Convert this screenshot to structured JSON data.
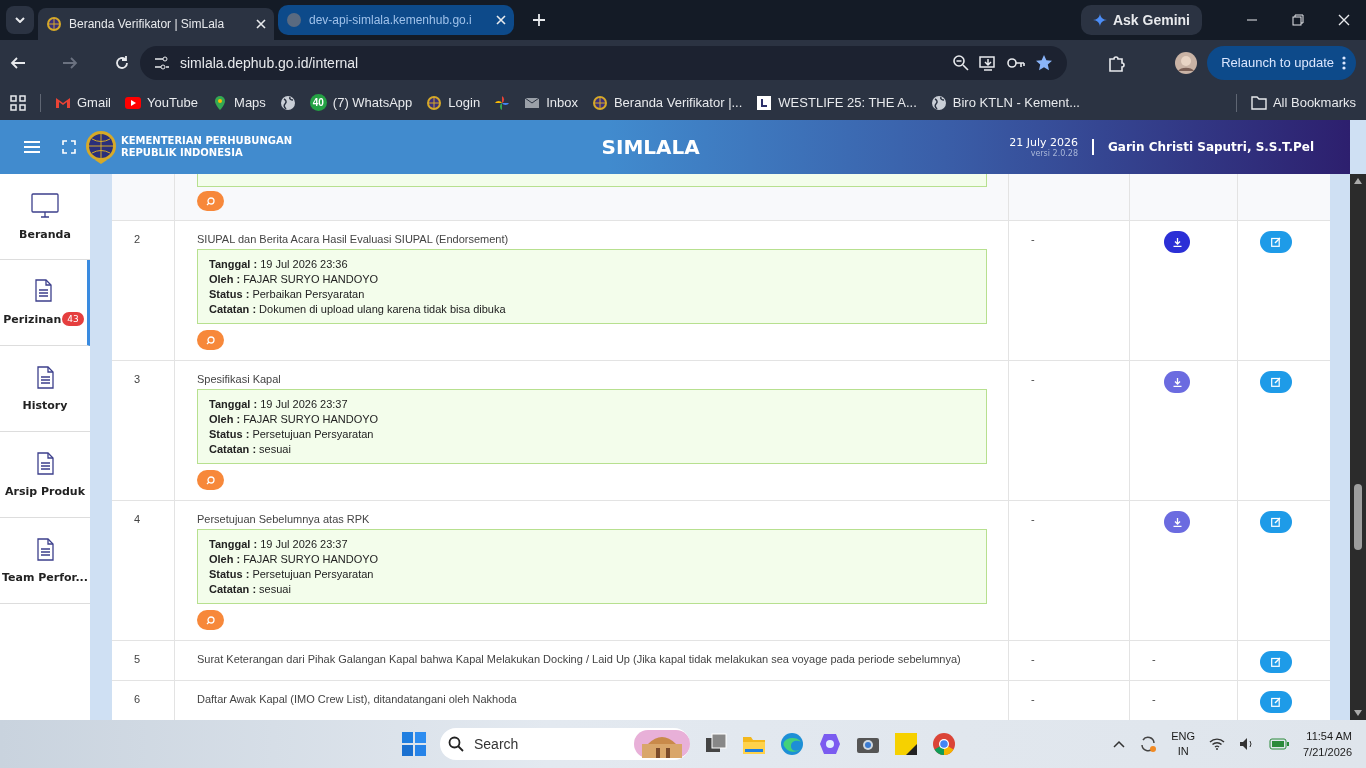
{
  "browser": {
    "tabs": [
      {
        "title": "Beranda Verifikator | SimLala",
        "selected": true
      },
      {
        "title": "dev-api-simlala.kemenhub.go.i",
        "selected": false
      }
    ],
    "gemini": "Ask Gemini",
    "address": "simlala.dephub.go.id/internal",
    "relaunch": "Relaunch to update",
    "bookmarks": [
      {
        "kind": "gmail",
        "label": "Gmail"
      },
      {
        "kind": "youtube",
        "label": "YouTube"
      },
      {
        "kind": "maps",
        "label": "Maps"
      },
      {
        "kind": "globe"
      },
      {
        "kind": "whatsapp",
        "badge": "40",
        "label": "(7) WhatsApp"
      },
      {
        "kind": "emblem",
        "label": "Login"
      },
      {
        "kind": "pinwheel"
      },
      {
        "kind": "mail",
        "label": "Inbox"
      },
      {
        "kind": "emblem",
        "label": "Beranda Verifikator |..."
      },
      {
        "kind": "letter",
        "label": "WESTLIFE 25: THE A..."
      },
      {
        "kind": "globe",
        "label": "Biro KTLN - Kement..."
      }
    ],
    "all_bookmarks": "All Bookmarks"
  },
  "header": {
    "org_line_1": "KEMENTERIAN PERHUBUNGAN",
    "org_line_2": "REPUBLIK INDONESIA",
    "title": "SIMLALA",
    "date": "21 July 2026",
    "version": "versi 2.0.28",
    "user": "Garin Christi Saputri, S.S.T.Pel"
  },
  "sidebar": {
    "items": [
      {
        "kind": "monitor",
        "label": "Beranda",
        "selected": false
      },
      {
        "kind": "document",
        "label": "Perizinan",
        "badge": "43",
        "selected": true
      },
      {
        "kind": "document",
        "label": "History",
        "selected": false
      },
      {
        "kind": "document",
        "label": "Arsip Produk",
        "selected": false
      },
      {
        "kind": "document",
        "label": "Team Perfor...",
        "selected": false
      }
    ]
  },
  "table": {
    "rows": [
      {
        "kind": "clipped"
      },
      {
        "kind": "entry",
        "number": "2",
        "title": "SIUPAL dan Berita Acara Hasil Evaluasi SIUPAL (Endorsement)",
        "details": [
          {
            "label": "Tanggal :",
            "value": "19 Jul 2026 23:36"
          },
          {
            "label": "Oleh :",
            "value": "FAJAR SURYO HANDOYO"
          },
          {
            "label": "Status :",
            "value": "Perbaikan Persyaratan"
          },
          {
            "label": "Catatan :",
            "value": "Dokumen di upload ulang karena tidak bisa dibuka"
          }
        ],
        "column_3": "-",
        "download": {
          "color": "#2b2fd6"
        }
      },
      {
        "kind": "entry",
        "number": "3",
        "title": "Spesifikasi Kapal",
        "details": [
          {
            "label": "Tanggal :",
            "value": "19 Jul 2026 23:37"
          },
          {
            "label": "Oleh :",
            "value": "FAJAR SURYO HANDOYO"
          },
          {
            "label": "Status :",
            "value": "Persetujuan Persyaratan"
          },
          {
            "label": "Catatan :",
            "value": "sesuai"
          }
        ],
        "column_3": "-",
        "download": {
          "color": "#6b6be0"
        }
      },
      {
        "kind": "entry",
        "number": "4",
        "title": "Persetujuan Sebelumnya atas RPK",
        "details": [
          {
            "label": "Tanggal :",
            "value": "19 Jul 2026 23:37"
          },
          {
            "label": "Oleh :",
            "value": "FAJAR SURYO HANDOYO"
          },
          {
            "label": "Status :",
            "value": "Persetujuan Persyaratan"
          },
          {
            "label": "Catatan :",
            "value": "sesuai"
          }
        ],
        "column_3": "-",
        "download": {
          "color": "#6b6be0"
        }
      },
      {
        "kind": "plain",
        "number": "5",
        "title": "Surat Keterangan dari Pihak Galangan Kapal bahwa Kapal Melakukan Docking / Laid Up (Jika kapal tidak melakukan sea voyage pada periode sebelumnya)",
        "column_3": "-",
        "column_4": "-"
      },
      {
        "kind": "plain",
        "number": "6",
        "title": "Daftar Awak Kapal (IMO Crew List), ditandatangani oleh Nakhoda",
        "column_3": "-",
        "column_4": "-"
      }
    ]
  },
  "taskbar": {
    "search": "Search",
    "language": "ENG",
    "region": "IN",
    "time": "11:54 AM",
    "date": "7/21/2026"
  }
}
